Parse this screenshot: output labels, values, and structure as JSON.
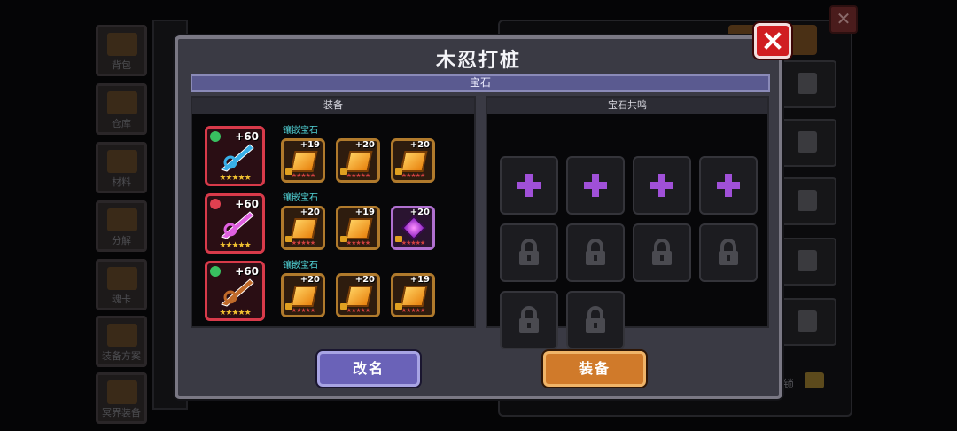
{
  "background": {
    "sidebar_tabs": [
      "背包",
      "仓库",
      "材料",
      "分解",
      "魂卡",
      "装备方案",
      "冥界装备"
    ],
    "lock_label": "锁"
  },
  "modal": {
    "title": "木忍打桩",
    "section": "宝石",
    "equip_panel_title": "装备",
    "resonance_panel_title": "宝石共鸣",
    "rows": [
      {
        "weapon_level": "+60",
        "weapon_gem_color": "#38c060",
        "weapon_color": "#38b0e8",
        "inlay_label": "镶嵌宝石",
        "inlays": [
          "+19",
          "+20",
          "+20"
        ]
      },
      {
        "weapon_level": "+60",
        "weapon_gem_color": "#e04050",
        "weapon_color": "#e060e0",
        "inlay_label": "镶嵌宝石",
        "inlays": [
          "+20",
          "+19",
          "+20"
        ]
      },
      {
        "weapon_level": "+60",
        "weapon_gem_color": "#38c060",
        "weapon_color": "#c06a2a",
        "inlay_label": "镶嵌宝石",
        "inlays": [
          "+20",
          "+20",
          "+19"
        ]
      }
    ],
    "resonance_slots": [
      "add",
      "add",
      "add",
      "add",
      "locked",
      "locked",
      "locked",
      "locked",
      "locked",
      "locked"
    ],
    "stars": "★★★★★",
    "rename_button": "改名",
    "equip_button": "装备"
  },
  "colors": {
    "accent_purple": "#6a62b8",
    "accent_orange": "#d07a2a",
    "close_red": "#d01e22",
    "plus_purple": "#a050d8",
    "lock_gray": "#4a4a50"
  }
}
